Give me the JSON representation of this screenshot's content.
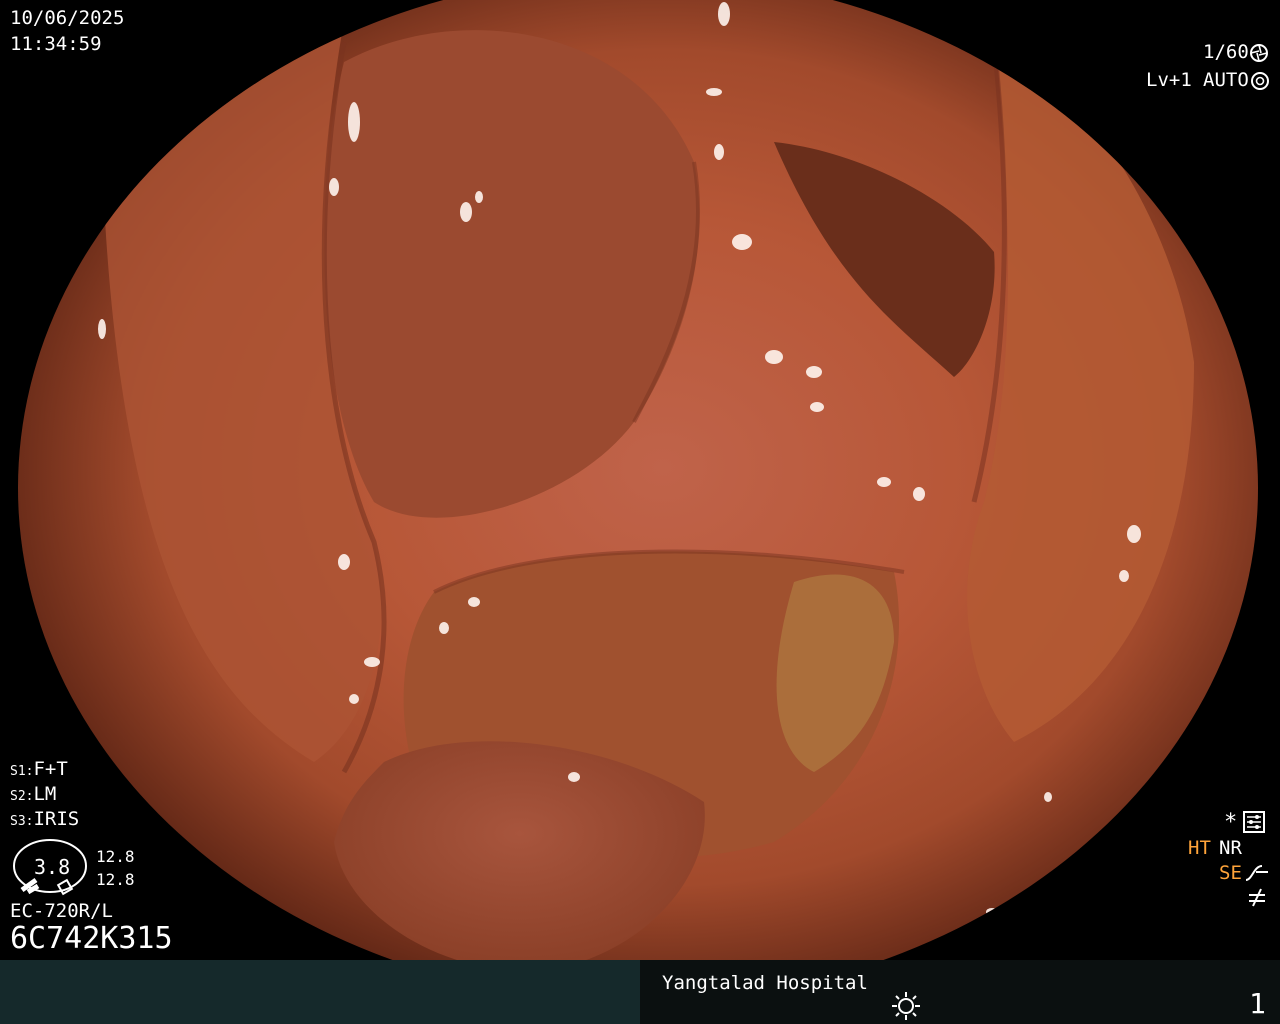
{
  "header": {
    "date": "10/06/2025",
    "time": "11:34:59",
    "shutter": "1/60",
    "level": "Lv+1",
    "iris_mode": "AUTO"
  },
  "settings": {
    "s1_label": "S1:",
    "s1_value": "F+T",
    "s2_label": "S2:",
    "s2_value": "LM",
    "s3_label": "S3:",
    "s3_value": "IRIS"
  },
  "zoom": {
    "value": "3.8",
    "top": "12.8",
    "bottom": "12.8"
  },
  "scope_model": "EC-720R/L",
  "serial": "6C742K315",
  "mode_indicators": {
    "asterisk": "*",
    "ht": "HT",
    "nr": "NR",
    "se": "SE"
  },
  "footer": {
    "hospital": "Yangtalad Hospital",
    "page_number": "1"
  },
  "colors": {
    "left_bar": "#15292b",
    "right_bar": "#0b1010",
    "accent": "#ffa43a"
  },
  "icons": [
    "shutter-icon",
    "iris-icon",
    "settings-icon",
    "se-curve-icon",
    "not-equal-icon",
    "brightness-icon",
    "zoom-cap-icon"
  ]
}
